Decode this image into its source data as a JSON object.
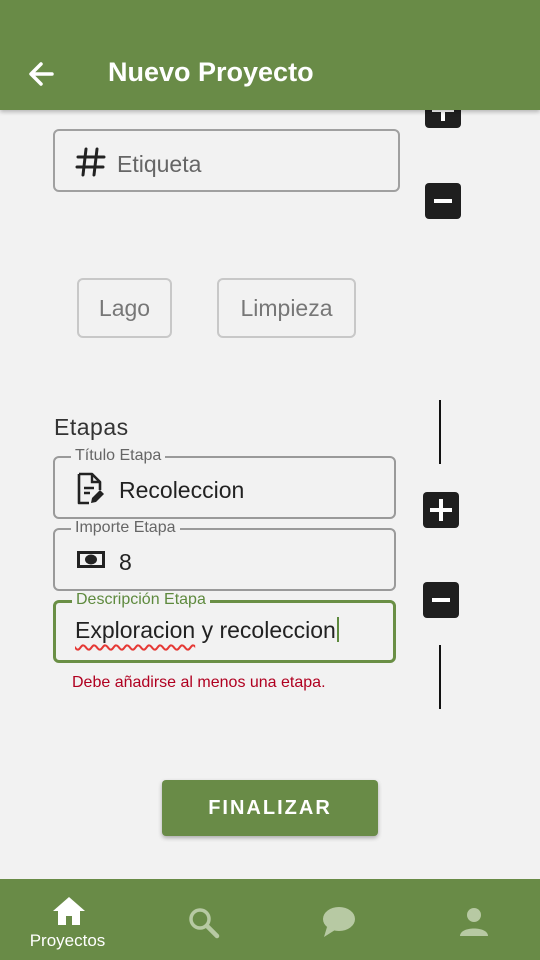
{
  "appbar": {
    "title": "Nuevo Proyecto",
    "back_icon": "arrow-left-icon"
  },
  "tag_field": {
    "placeholder": "Etiqueta",
    "icon": "hash-icon"
  },
  "chips": [
    {
      "label": "Lago"
    },
    {
      "label": "Limpieza"
    }
  ],
  "stages": {
    "section_title": "Etapas",
    "title_field": {
      "label": "Título Etapa",
      "value": "Recoleccion",
      "icon": "document-edit-icon"
    },
    "amount_field": {
      "label": "Importe Etapa",
      "value": "8",
      "icon": "cash-icon"
    },
    "description_field": {
      "label": "Descripción Etapa",
      "value_misspelled": "Exploracion",
      "value_rest": " y recoleccion"
    },
    "error": "Debe añadirse al menos una etapa."
  },
  "finalize_label": "FINALIZAR",
  "bottom_nav": {
    "items": [
      {
        "label": "Proyectos",
        "icon": "home-icon"
      },
      {
        "label": "",
        "icon": "search-icon"
      },
      {
        "label": "",
        "icon": "chat-icon"
      },
      {
        "label": "",
        "icon": "person-icon"
      }
    ]
  },
  "colors": {
    "primary": "#698b47",
    "focus_label": "#5e8a3e",
    "error": "#b00020",
    "button_dark": "#1f1f1f"
  }
}
